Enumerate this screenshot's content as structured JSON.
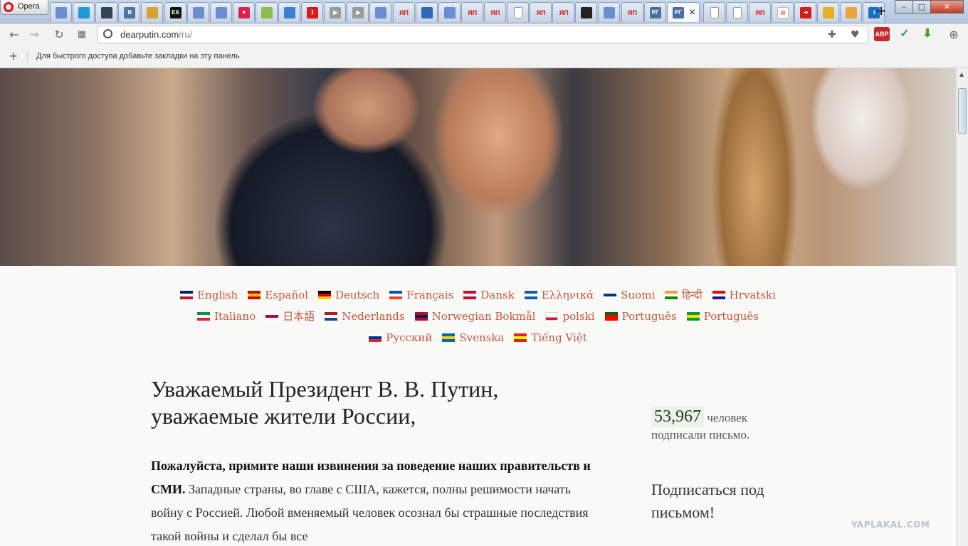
{
  "browser": {
    "app_name": "Opera",
    "tab_count": 35,
    "active_tab_index": 27,
    "new_tab_label": "+",
    "window_controls": {
      "minimize": "–",
      "maximize": "□",
      "close": "✕"
    }
  },
  "tabs": [
    {
      "icon": "yaplakal-icon",
      "color": "#6a8fd0",
      "text": ""
    },
    {
      "icon": "skype-icon",
      "color": "#1d9ad6",
      "text": ""
    },
    {
      "icon": "camera-icon",
      "color": "#334455",
      "text": ""
    },
    {
      "icon": "vk-icon",
      "color": "#4c75a3",
      "text": "B"
    },
    {
      "icon": "eye-icon",
      "color": "#d9a233",
      "text": ""
    },
    {
      "icon": "ea-icon",
      "color": "#111111",
      "text": "EA"
    },
    {
      "icon": "yaplakal-icon",
      "color": "#6a8fd0",
      "text": ""
    },
    {
      "icon": "yaplakal-icon",
      "color": "#6a8fd0",
      "text": ""
    },
    {
      "icon": "pirat-heart-icon",
      "color": "#e0204a",
      "text": "♥"
    },
    {
      "icon": "swirl-icon",
      "color": "#8bbd4a",
      "text": ""
    },
    {
      "icon": "bird-icon",
      "color": "#3a7fd0",
      "text": ""
    },
    {
      "icon": "channel-one-icon",
      "color": "#d81b1b",
      "text": "1"
    },
    {
      "icon": "play-icon",
      "color": "#9a9a9a",
      "text": "▶"
    },
    {
      "icon": "play-icon",
      "color": "#9a9a9a",
      "text": "▶"
    },
    {
      "icon": "yaplakal-icon",
      "color": "#6a8fd0",
      "text": ""
    },
    {
      "icon": "yap-text-icon",
      "color": "#d21111",
      "text": "ЯП"
    },
    {
      "icon": "globe-icon",
      "color": "#2d6bb7",
      "text": ""
    },
    {
      "icon": "yaplakal-icon",
      "color": "#6a8fd0",
      "text": ""
    },
    {
      "icon": "yap-text-icon",
      "color": "#d21111",
      "text": "ЯП"
    },
    {
      "icon": "yap-text-icon",
      "color": "#d21111",
      "text": "ЯП"
    },
    {
      "icon": "document-icon",
      "color": "#ffffff",
      "text": ""
    },
    {
      "icon": "yap-text-icon",
      "color": "#d21111",
      "text": "ЯП"
    },
    {
      "icon": "yap-text-icon",
      "color": "#d21111",
      "text": "ЯП"
    },
    {
      "icon": "film-icon",
      "color": "#222222",
      "text": ""
    },
    {
      "icon": "yaplakal-icon",
      "color": "#6a8fd0",
      "text": ""
    },
    {
      "icon": "yap-text-icon",
      "color": "#d21111",
      "text": "ЯП"
    },
    {
      "icon": "rg-icon",
      "color": "#4a6fa5",
      "text": "РГ"
    },
    {
      "icon": "rg-icon",
      "color": "#4a6fa5",
      "text": "РГ"
    },
    {
      "icon": "document-icon",
      "color": "#ffffff",
      "text": ""
    },
    {
      "icon": "document-icon",
      "color": "#ffffff",
      "text": ""
    },
    {
      "icon": "yap-text-icon",
      "color": "#d21111",
      "text": "ЯП"
    },
    {
      "icon": "yandex-icon",
      "color": "#ffffff",
      "text": "Я"
    },
    {
      "icon": "red-arrow-icon",
      "color": "#d41b1b",
      "text": "➜"
    },
    {
      "icon": "shield-icon",
      "color": "#e3b21d",
      "text": ""
    },
    {
      "icon": "smiley-icon",
      "color": "#e8a640",
      "text": ""
    },
    {
      "icon": "blue-t-icon",
      "color": "#1d6fc4",
      "text": "t"
    }
  ],
  "address_bar": {
    "url_host": "dearputin.com",
    "url_path": "/ru/"
  },
  "extensions": [
    {
      "icon": "abp-icon",
      "color": "#c7282b",
      "text": "ABP"
    },
    {
      "icon": "check-shield-icon",
      "color": "#3a9e3a",
      "text": "✓"
    },
    {
      "icon": "download-arrow-icon",
      "color": "#4ca52a",
      "text": "⬇"
    }
  ],
  "bookmarks_bar": {
    "hint": "Для быстрого доступа добавьте закладки на эту панель"
  },
  "languages": {
    "rows": [
      [
        {
          "label": "English",
          "flag": [
            "#012169",
            "#ffffff",
            "#c8102e"
          ]
        },
        {
          "label": "Español",
          "flag": [
            "#c60b1e",
            "#ffc400",
            "#c60b1e"
          ]
        },
        {
          "label": "Deutsch",
          "flag": [
            "#000000",
            "#dd0000",
            "#ffce00"
          ]
        },
        {
          "label": "Français",
          "flag": [
            "#0055a4",
            "#ffffff",
            "#ef4135"
          ]
        },
        {
          "label": "Dansk",
          "flag": [
            "#c60c30",
            "#ffffff",
            "#c60c30"
          ]
        },
        {
          "label": "Ελληνικά",
          "flag": [
            "#0d5eaf",
            "#ffffff",
            "#0d5eaf"
          ]
        },
        {
          "label": "Suomi",
          "flag": [
            "#ffffff",
            "#003580",
            "#ffffff"
          ]
        },
        {
          "label": "हिन्दी",
          "flag": [
            "#ff9933",
            "#ffffff",
            "#138808"
          ]
        },
        {
          "label": "Hrvatski",
          "flag": [
            "#ff0000",
            "#ffffff",
            "#171796"
          ]
        }
      ],
      [
        {
          "label": "Italiano",
          "flag": [
            "#009246",
            "#ffffff",
            "#ce2b37"
          ]
        },
        {
          "label": "日本語",
          "flag": [
            "#ffffff",
            "#bc002d",
            "#ffffff"
          ]
        },
        {
          "label": "Nederlands",
          "flag": [
            "#ae1c28",
            "#ffffff",
            "#21468b"
          ]
        },
        {
          "label": "Norwegian Bokmål",
          "flag": [
            "#ba0c2f",
            "#00205b",
            "#ba0c2f"
          ]
        },
        {
          "label": "polski",
          "flag": [
            "#ffffff",
            "#ffffff",
            "#dc143c"
          ]
        },
        {
          "label": "Português",
          "flag": [
            "#006600",
            "#ff0000",
            "#ff0000"
          ]
        },
        {
          "label": "Português",
          "flag": [
            "#009c3b",
            "#ffdf00",
            "#009c3b"
          ]
        }
      ],
      [
        {
          "label": "Русский",
          "flag": [
            "#ffffff",
            "#0039a6",
            "#d52b1e"
          ]
        },
        {
          "label": "Svenska",
          "flag": [
            "#006aa7",
            "#fecc00",
            "#006aa7"
          ]
        },
        {
          "label": "Tiếng Việt",
          "flag": [
            "#da251d",
            "#ffff00",
            "#da251d"
          ]
        }
      ]
    ]
  },
  "letter": {
    "title_line1": "Уважаемый Президент В. В. Путин,",
    "title_line2": "уважаемые жители России,",
    "body_bold": "Пожалуйста, примите наши извинения за поведение наших правительств и СМИ.",
    "body_text": " Западные страны, во главе с США, кажется, полны решимости начать войну с Россией. Любой вменяемый человек осознал бы страшные последствия такой войны и сделал бы все"
  },
  "sidebar": {
    "count": "53,967",
    "count_label_line1": "человек",
    "count_label_line2": "подписали письмо.",
    "signup": "Подписаться под письмом!"
  },
  "watermark": "YAPLAKAL.COM"
}
